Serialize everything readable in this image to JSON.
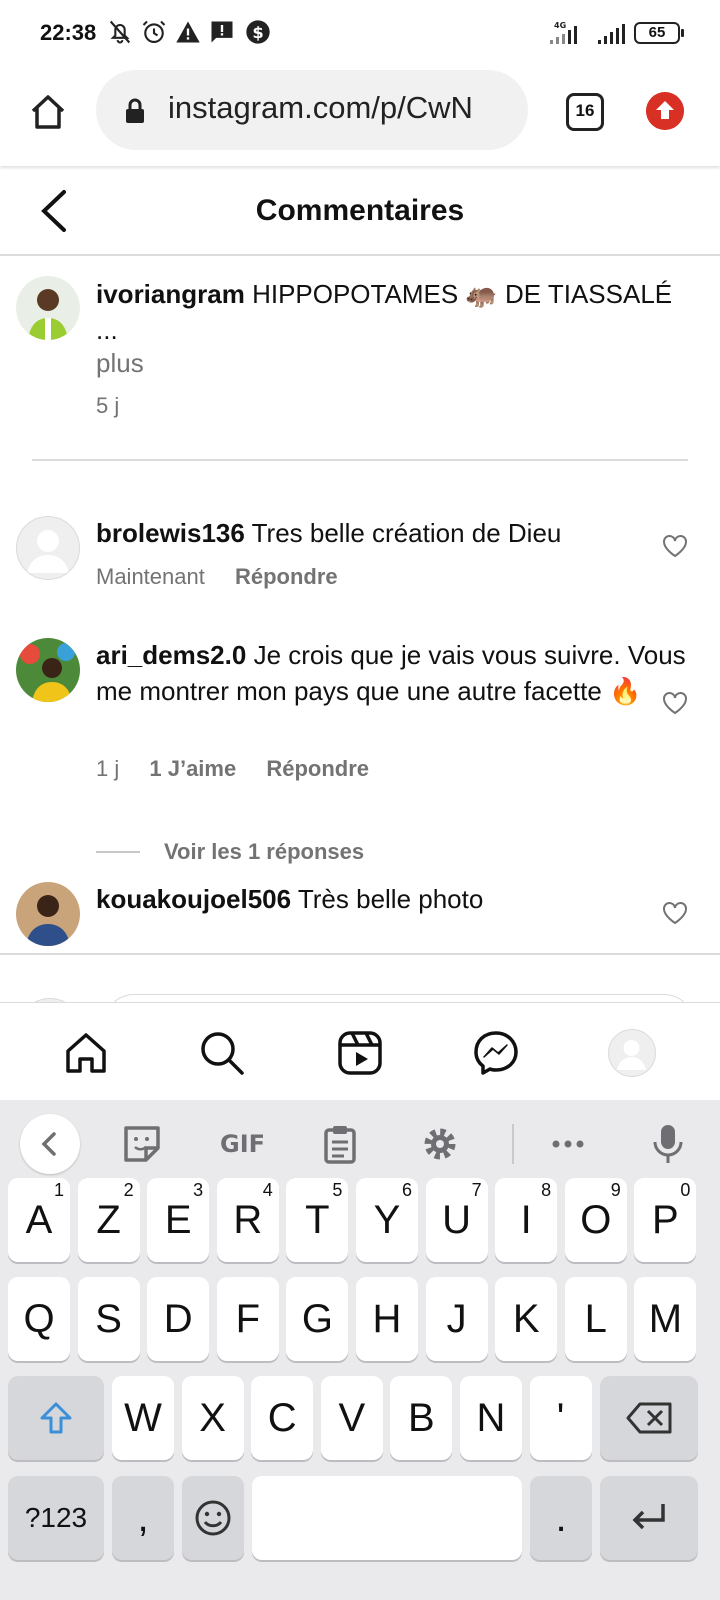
{
  "status_bar": {
    "time": "22:38",
    "network": "4G",
    "battery": "65",
    "icons": [
      "bell-off-icon",
      "alarm-icon",
      "warning-icon",
      "message-alert-icon",
      "dollar-icon"
    ]
  },
  "browser": {
    "url": "instagram.com/p/CwN",
    "tab_count": "16"
  },
  "header": {
    "title": "Commentaires"
  },
  "post": {
    "username": "ivoriangram",
    "caption": "HIPPOPOTAMES 🦛 DE TIASSALÉ",
    "ellipsis": "...",
    "more_label": "plus",
    "age": "5 j"
  },
  "comments": [
    {
      "username": "brolewis136",
      "text": "Tres belle création de Dieu",
      "time": "Maintenant",
      "reply_label": "Répondre"
    },
    {
      "username": "ari_dems2.0",
      "text": "Je crois que je vais vous suivre. Vous me montrer mon pays que une autre facette 🔥",
      "time": "1 j",
      "likes": "1 J’aime",
      "reply_label": "Répondre",
      "view_replies": "Voir les 1 réponses"
    },
    {
      "username": "kouakoujoel506",
      "text": "Très belle photo"
    }
  ],
  "keyboard": {
    "gif_label": "GIF",
    "row1": [
      {
        "k": "A",
        "n": "1"
      },
      {
        "k": "Z",
        "n": "2"
      },
      {
        "k": "E",
        "n": "3"
      },
      {
        "k": "R",
        "n": "4"
      },
      {
        "k": "T",
        "n": "5"
      },
      {
        "k": "Y",
        "n": "6"
      },
      {
        "k": "U",
        "n": "7"
      },
      {
        "k": "I",
        "n": "8"
      },
      {
        "k": "O",
        "n": "9"
      },
      {
        "k": "P",
        "n": "0"
      }
    ],
    "row2": [
      "Q",
      "S",
      "D",
      "F",
      "G",
      "H",
      "J",
      "K",
      "L",
      "M"
    ],
    "row3": [
      "W",
      "X",
      "C",
      "V",
      "B",
      "N",
      "'"
    ],
    "symbols_label": "?123",
    "comma": ",",
    "period": "."
  },
  "colors": {
    "update_badge": "#d93025",
    "shift_arrow": "#3b8fd9",
    "meta_gray": "#737373"
  }
}
